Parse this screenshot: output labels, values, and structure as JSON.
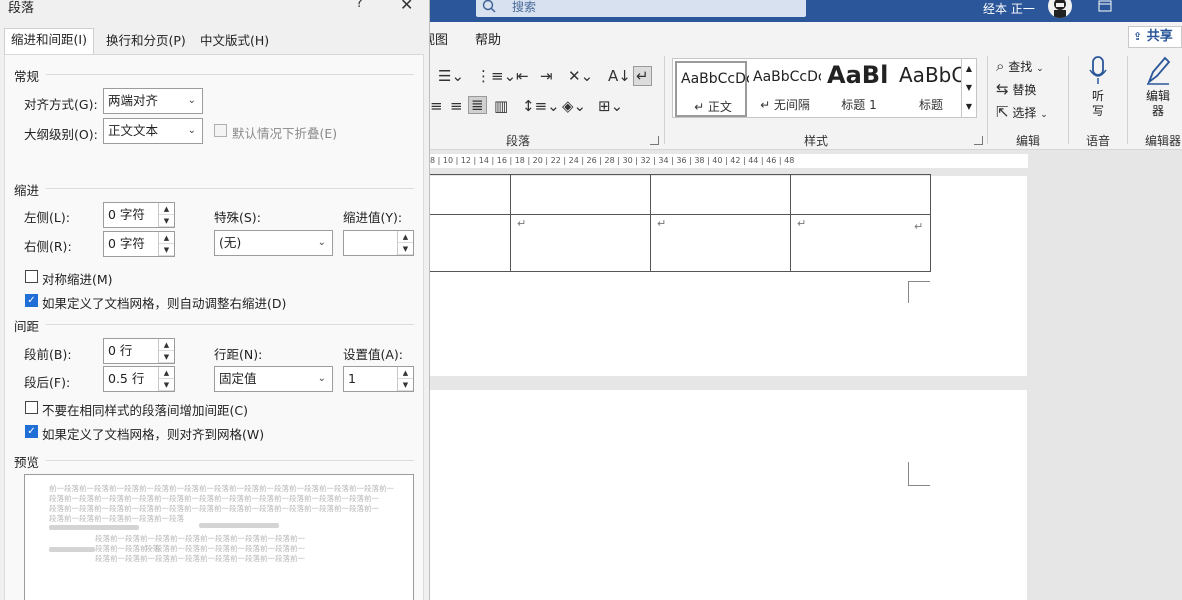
{
  "dialog": {
    "title": "段落",
    "help": "?",
    "close": "✕",
    "tabs": [
      "缩进和间距(I)",
      "换行和分页(P)",
      "中文版式(H)"
    ],
    "general": {
      "section": "常规",
      "alignment_label": "对齐方式(G):",
      "alignment_value": "两端对齐",
      "outline_label": "大纲级别(O):",
      "outline_value": "正文文本",
      "collapse_label": "默认情况下折叠(E)"
    },
    "indent": {
      "section": "缩进",
      "left_label": "左侧(L):",
      "left_value": "0 字符",
      "right_label": "右侧(R):",
      "right_value": "0 字符",
      "special_label": "特殊(S):",
      "special_value": "(无)",
      "by_label": "缩进值(Y):",
      "by_value": "",
      "mirror_label": "对称缩进(M)",
      "mirror_checked": false,
      "auto_right_label": "如果定义了文档网格，则自动调整右缩进(D)",
      "auto_right_checked": true
    },
    "spacing": {
      "section": "间距",
      "before_label": "段前(B):",
      "before_value": "0 行",
      "after_label": "段后(F):",
      "after_value": "0.5 行",
      "line_label": "行距(N):",
      "line_value": "固定值",
      "at_label": "设置值(A):",
      "at_value": "1",
      "no_space_label": "不要在相同样式的段落间增加间距(C)",
      "no_space_checked": false,
      "snap_grid_label": "如果定义了文档网格，则对齐到网格(W)",
      "snap_grid_checked": true
    },
    "preview": {
      "section": "预览",
      "lines": [
        "前一段落前一段落前一段落前一段落前一段落前一段落前一段落前一段落前一段落前一段落前一段落前一",
        "段落前一段落前一段落前一段落前一段落前一段落前一段落前一段落前一段落前一段落前一段落前一",
        "段落前一段落前一段落前一段落前一段落前一段落前一段落前一段落前一段落前一段落前一段落前一",
        "段落前一段落前一段落前一段落前一段落",
        "段落前一段落前一段落前一段落前一段落前一段落前一段落前一",
        "段落前一段落前一段落前一段落前一段落前一段落前一段落前一",
        "段落前一段落前一段落前一段落前一段落前一段落前一段落前一",
        "段落"
      ]
    }
  },
  "word": {
    "search_placeholder": "搜索",
    "user_name": "经本 正一",
    "share": "共享",
    "menu": [
      "视图",
      "帮助"
    ],
    "groups": {
      "paragraph": "段落",
      "styles": "样式",
      "editing": "编辑",
      "voice": "语音",
      "editor": "编辑器"
    },
    "styles": [
      {
        "preview": "AaBbCcDc",
        "name": "↵ 正文"
      },
      {
        "preview": "AaBbCcDc",
        "name": "↵ 无间隔"
      },
      {
        "preview": "AaBl",
        "name": "标题 1"
      },
      {
        "preview": "AaBbC",
        "name": "标题"
      }
    ],
    "editing": {
      "find": "查找",
      "replace": "替换",
      "select": "选择"
    },
    "voice_btn": "听写",
    "editor_btn": "编辑器",
    "ruler_ticks": "8 | 10 | 12 | 14 | 16 | 18 | 20 | 22 | 24 | 26 | 28 | 30 | 32 | 34 | 36 | 38 | 40 | 42 | 44 | 46 | 48",
    "para_mark": "↵",
    "icons": [
      "search-icon",
      "numbering-icon",
      "multilevel-list-icon",
      "decrease-indent-icon",
      "increase-indent-icon",
      "sort-icon",
      "show-marks-icon",
      "align-center-icon",
      "align-right-icon",
      "justify-icon",
      "distributed-icon",
      "line-spacing-icon",
      "shading-icon",
      "borders-icon",
      "find-icon",
      "replace-icon",
      "select-icon",
      "microphone-icon",
      "editor-pen-icon"
    ],
    "accent": "#2b579a"
  }
}
